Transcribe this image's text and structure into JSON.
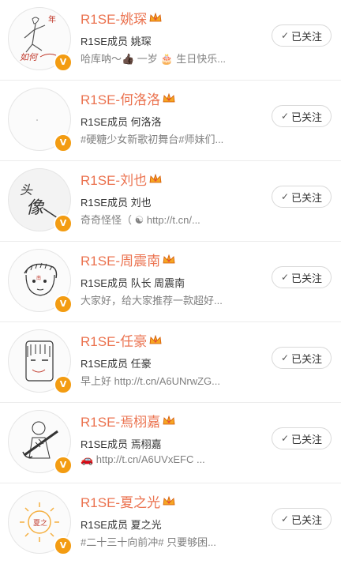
{
  "follow_label": "已关注",
  "accent_color": "#eb7350",
  "verified_badge": "V",
  "users": [
    {
      "name": "R1SE-姚琛",
      "desc": "R1SE成员 姚琛",
      "intro": "哈库呐～👍🏿 一岁 🎂 生日快乐...",
      "avatar_icon": "handdrawn-figure-avatar"
    },
    {
      "name": "R1SE-何洛洛",
      "desc": "R1SE成员 何洛洛",
      "intro": "#硬糖少女新歌初舞台#师妹们...",
      "avatar_icon": "blank-avatar"
    },
    {
      "name": "R1SE-刘也",
      "desc": "R1SE成员 刘也",
      "intro": "奇奇怪怪（ ☯ http://t.cn/...",
      "avatar_icon": "handwritten-touxiang-avatar"
    },
    {
      "name": "R1SE-周震南",
      "desc": "R1SE成员 队长 周震南",
      "intro": "大家好，给大家推荐一款超好...",
      "avatar_icon": "sketch-face-avatar"
    },
    {
      "name": "R1SE-任豪",
      "desc": "R1SE成员 任豪",
      "intro": "早上好 http://t.cn/A6UNrwZG...",
      "avatar_icon": "sketch-face-avatar"
    },
    {
      "name": "R1SE-焉栩嘉",
      "desc": "R1SE成员 焉栩嘉",
      "intro": "🚗 http://t.cn/A6UVxEFC ...",
      "avatar_icon": "sketch-guitar-avatar"
    },
    {
      "name": "R1SE-夏之光",
      "desc": "R1SE成员 夏之光",
      "intro": "#二十三十向前冲# 只要够困...",
      "avatar_icon": "sun-sketch-avatar"
    }
  ]
}
